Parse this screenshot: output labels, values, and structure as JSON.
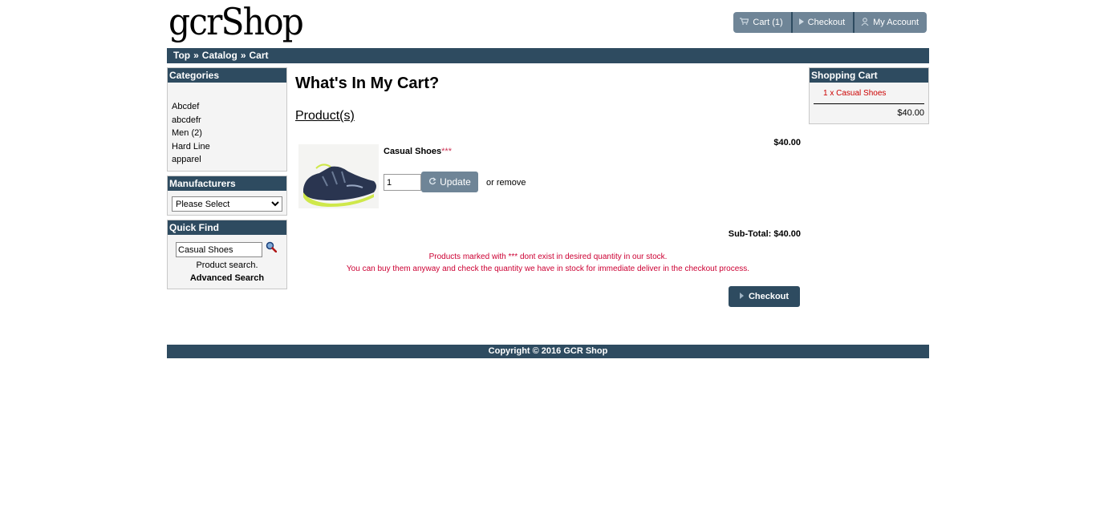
{
  "header": {
    "logo_text": "gcrShop",
    "nav": [
      {
        "icon": "cart-icon",
        "label": "Cart (1)"
      },
      {
        "icon": "play-icon",
        "label": "Checkout"
      },
      {
        "icon": "user-icon",
        "label": "My Account"
      }
    ]
  },
  "breadcrumb": {
    "items": [
      "Top",
      "Catalog",
      "Cart"
    ],
    "separator": "»"
  },
  "categories": {
    "title": "Categories",
    "items": [
      "Abcdef",
      "abcdefr",
      "Men (2)",
      "Hard Line",
      "apparel"
    ]
  },
  "manufacturers": {
    "title": "Manufacturers",
    "selected": "Please Select"
  },
  "quick_find": {
    "title": "Quick Find",
    "search_value": "Casual Shoes",
    "label": "Product search.",
    "advanced_link": "Advanced Search"
  },
  "shopping_cart_box": {
    "title": "Shopping Cart",
    "item": "1 x Casual Shoes",
    "total": "$40.00"
  },
  "main": {
    "title": "What's In My Cart?",
    "section_heading": "Product(s)",
    "product": {
      "name": "Casual Shoes",
      "stock_mark": "***",
      "price": "$40.00",
      "quantity": "1",
      "update_label": "Update",
      "remove_text": "or remove"
    },
    "subtotal": "Sub-Total: $40.00",
    "notice_line1": "Products marked with *** dont exist in desired quantity in our stock.",
    "notice_line2": "You can buy them anyway and check the quantity we have in stock for immediate deliver in the checkout process.",
    "checkout_label": "Checkout"
  },
  "footer": {
    "copyright": "Copyright © 2016 GCR Shop"
  },
  "colors": {
    "header_bar": "#2e4b60",
    "button_grey": "#6f8597",
    "warning_red": "#cc0033"
  }
}
